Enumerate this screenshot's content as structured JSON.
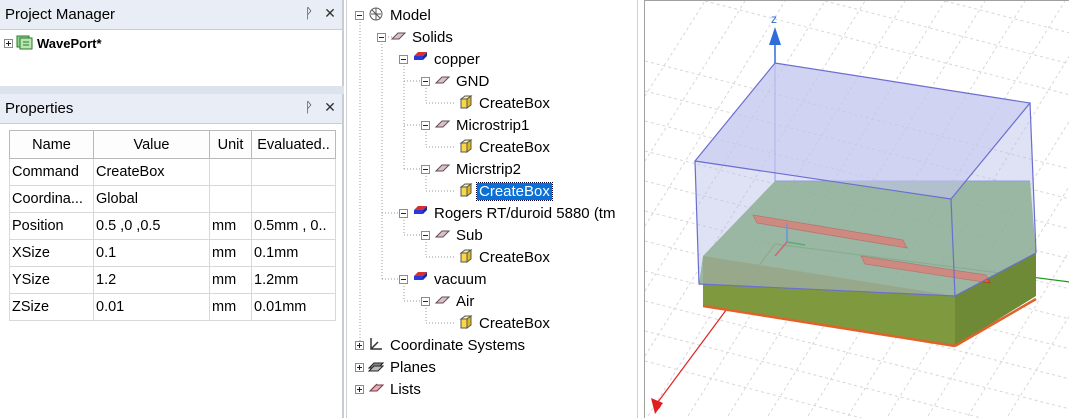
{
  "project_manager": {
    "title": "Project Manager",
    "pin_icon": "pin-icon",
    "close_icon": "close-icon",
    "project_name": "WavePort*"
  },
  "properties": {
    "title": "Properties",
    "columns": [
      "Name",
      "Value",
      "Unit",
      "Evaluated.."
    ],
    "rows": [
      {
        "name": "Command",
        "value": "CreateBox",
        "unit": "",
        "evaluated": ""
      },
      {
        "name": "Coordina...",
        "value": "Global",
        "unit": "",
        "evaluated": ""
      },
      {
        "name": "Position",
        "value": "0.5 ,0 ,0.5",
        "unit": "mm",
        "evaluated": "0.5mm , 0.."
      },
      {
        "name": "XSize",
        "value": "0.1",
        "unit": "mm",
        "evaluated": "0.1mm"
      },
      {
        "name": "YSize",
        "value": "1.2",
        "unit": "mm",
        "evaluated": "1.2mm"
      },
      {
        "name": "ZSize",
        "value": "0.01",
        "unit": "mm",
        "evaluated": "0.01mm"
      }
    ]
  },
  "tree": {
    "model": "Model",
    "solids": "Solids",
    "copper": "copper",
    "gnd": "GND",
    "gnd_create": "CreateBox",
    "microstrip1": "Microstrip1",
    "ms1_create": "CreateBox",
    "micrstrip2": "Micrstrip2",
    "ms2_create": "CreateBox",
    "rogers": "Rogers RT/duroid 5880 (tm",
    "sub": "Sub",
    "sub_create": "CreateBox",
    "vacuum": "vacuum",
    "air": "Air",
    "air_create": "CreateBox",
    "coordinate_systems": "Coordinate Systems",
    "planes": "Planes",
    "lists": "Lists"
  },
  "view3d": {
    "z_axis_label": "z",
    "colors": {
      "air_box_face": "#b8bce8",
      "air_box_edge": "#5a5ec8",
      "substrate": "#5c9a46",
      "substrate_front": "#6f8f2f",
      "microstrip": "#e0622a",
      "ground_edge": "#e0622a",
      "z_axis": "#2f6ed8",
      "x_axis": "#e02020",
      "y_axis": "#1a9a1a"
    }
  }
}
